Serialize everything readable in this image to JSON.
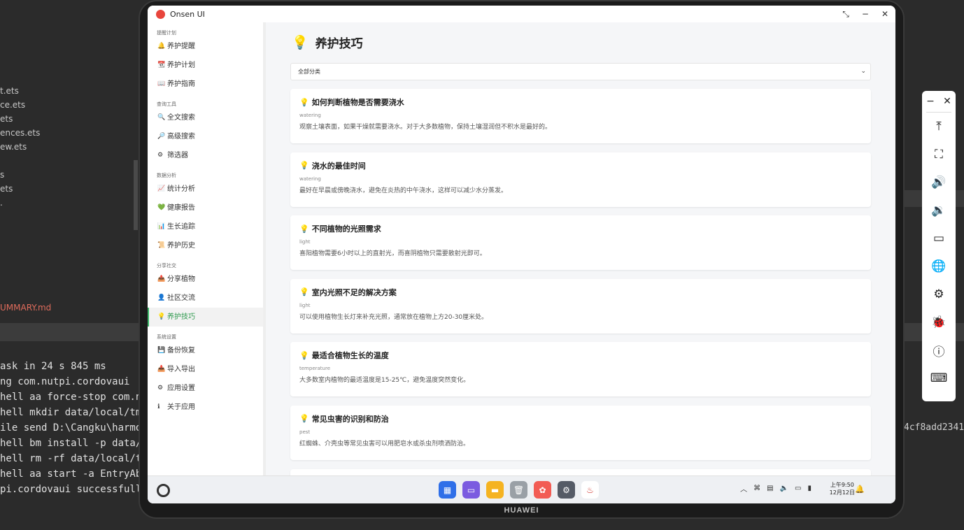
{
  "ide": {
    "files": [
      "t.ets",
      "ce.ets",
      "ets",
      "ences.ets",
      "ew.ets",
      "",
      "s",
      "ets",
      "."
    ],
    "summary_file": "UMMARY.md",
    "terminal": [
      "ask in 24 s 845 ms",
      "ng com.nutpi.cordovaui",
      "hell aa force-stop com.nu",
      "hell mkdir data/local/tmp",
      "ile send D:\\Cangku\\harmon",
      "hell bm install -p data/l",
      "hell rm -rf data/local/tm",
      "hell aa start -a EntryAbi",
      "pi.cordovaui successfully"
    ],
    "terminal_right": "4cf8add2341"
  },
  "device": {
    "brand": "HUAWEI"
  },
  "window": {
    "title": "Onsen UI",
    "controls": [
      "⤡",
      "−",
      "✕"
    ]
  },
  "sidebar": {
    "sections": [
      {
        "title": "提醒计划",
        "items": [
          {
            "icon": "🔔",
            "label": "养护提醒"
          },
          {
            "icon": "📆",
            "label": "养护计划"
          },
          {
            "icon": "📖",
            "label": "养护指南"
          }
        ]
      },
      {
        "title": "查询工具",
        "items": [
          {
            "icon": "🔍",
            "label": "全文搜索"
          },
          {
            "icon": "🔎",
            "label": "高级搜索"
          },
          {
            "icon": "⚙",
            "label": "筛选器"
          }
        ]
      },
      {
        "title": "数据分析",
        "items": [
          {
            "icon": "📈",
            "label": "统计分析"
          },
          {
            "icon": "💚",
            "label": "健康报告"
          },
          {
            "icon": "📊",
            "label": "生长追踪"
          },
          {
            "icon": "📜",
            "label": "养护历史"
          }
        ]
      },
      {
        "title": "分享社交",
        "items": [
          {
            "icon": "📤",
            "label": "分享植物"
          },
          {
            "icon": "👤",
            "label": "社区交流"
          },
          {
            "icon": "💡",
            "label": "养护技巧",
            "active": true
          }
        ]
      },
      {
        "title": "系统设置",
        "items": [
          {
            "icon": "💾",
            "label": "备份恢复"
          },
          {
            "icon": "📥",
            "label": "导入导出"
          },
          {
            "icon": "⚙",
            "label": "应用设置"
          },
          {
            "icon": "ℹ",
            "label": "关于应用"
          }
        ]
      }
    ]
  },
  "main": {
    "title_icon": "💡",
    "title": "养护技巧",
    "filter": {
      "selected": "全部分类",
      "chevron": "⌄"
    },
    "tips": [
      {
        "title": "如何判断植物是否需要浇水",
        "category": "watering",
        "desc": "观察土壤表面，如果干燥就需要浇水。对于大多数植物，保持土壤湿润但不积水是最好的。"
      },
      {
        "title": "浇水的最佳时间",
        "category": "watering",
        "desc": "最好在早晨或傍晚浇水，避免在炎热的中午浇水，这样可以减少水分蒸发。"
      },
      {
        "title": "不同植物的光照需求",
        "category": "light",
        "desc": "喜阳植物需要6小时以上的直射光，而喜阴植物只需要散射光即可。"
      },
      {
        "title": "室内光照不足的解决方案",
        "category": "light",
        "desc": "可以使用植物生长灯来补充光照，通常放在植物上方20-30厘米处。"
      },
      {
        "title": "最适合植物生长的温度",
        "category": "temperature",
        "desc": "大多数室内植物的最适温度是15-25℃，避免温度突然变化。"
      },
      {
        "title": "常见虫害的识别和防治",
        "category": "pest",
        "desc": "红蜘蛛、介壳虫等常见虫害可以用肥皂水或杀虫剂喷洒防治。"
      }
    ]
  },
  "taskbar": {
    "dock": [
      {
        "name": "app-grid-icon",
        "color": "#2f6fe8",
        "glyph": "▦"
      },
      {
        "name": "multitask-icon",
        "color": "#7b5be0",
        "glyph": "▭"
      },
      {
        "name": "notes-icon",
        "color": "#f5b321",
        "glyph": "▬"
      },
      {
        "name": "trash-icon",
        "color": "#9aa0a6",
        "glyph": "🗑"
      },
      {
        "name": "gallery-icon",
        "color": "#f25c54",
        "glyph": "✿"
      },
      {
        "name": "settings-icon",
        "color": "#555b66",
        "glyph": "⚙"
      },
      {
        "name": "onsen-app-icon",
        "color": "#ffffff",
        "glyph": "♨"
      }
    ],
    "time": "上午9:50",
    "date": "12月12日"
  },
  "right_toolbar": {
    "items": [
      {
        "name": "scroll-top-icon",
        "glyph": "⤒"
      },
      {
        "name": "crop-icon",
        "glyph": "⛶"
      },
      {
        "name": "volume-up-icon",
        "glyph": "🔊"
      },
      {
        "name": "volume-down-icon",
        "glyph": "🔉"
      },
      {
        "name": "label-icon",
        "glyph": "▭"
      },
      {
        "name": "globe-icon",
        "glyph": "🌐"
      },
      {
        "name": "settings-icon",
        "glyph": "⚙"
      },
      {
        "name": "debug-icon",
        "glyph": "🐞"
      },
      {
        "name": "info-icon",
        "glyph": "ⓘ"
      },
      {
        "name": "keyboard-icon",
        "glyph": "⌨"
      }
    ]
  },
  "colors": {
    "accent": "#3cb96a",
    "brand_red": "#e8453c"
  }
}
